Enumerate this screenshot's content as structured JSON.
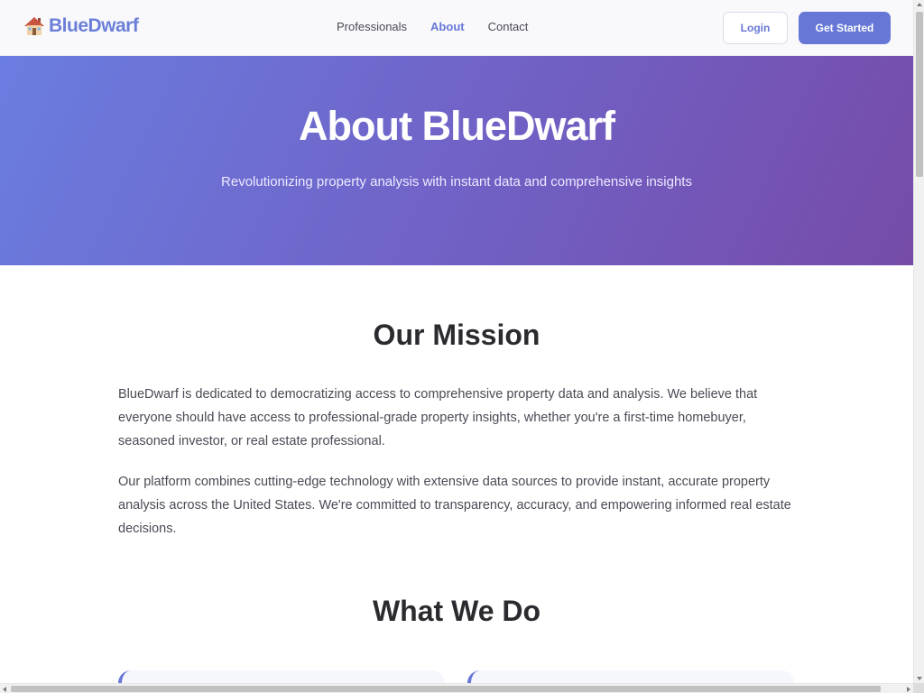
{
  "header": {
    "brand": "BlueDwarf",
    "brand_icon": "house-icon",
    "nav": [
      {
        "label": "Professionals",
        "active": false
      },
      {
        "label": "About",
        "active": true
      },
      {
        "label": "Contact",
        "active": false
      }
    ],
    "login_label": "Login",
    "get_started_label": "Get Started"
  },
  "hero": {
    "title": "About BlueDwarf",
    "subtitle": "Revolutionizing property analysis with instant data and comprehensive insights"
  },
  "mission": {
    "title": "Our Mission",
    "paragraphs": [
      "BlueDwarf is dedicated to democratizing access to comprehensive property data and analysis. We believe that everyone should have access to professional-grade property insights, whether you're a first-time homebuyer, seasoned investor, or real estate professional.",
      "Our platform combines cutting-edge technology with extensive data sources to provide instant, accurate property analysis across the United States. We're committed to transparency, accuracy, and empowering informed real estate decisions."
    ]
  },
  "what_we_do": {
    "title": "What We Do"
  },
  "colors": {
    "accent": "#6677d6",
    "hero_gradient_start": "#6a7de0",
    "hero_gradient_end": "#764ba8",
    "heading": "#2b2b2f",
    "body_text": "#4a4a55"
  }
}
